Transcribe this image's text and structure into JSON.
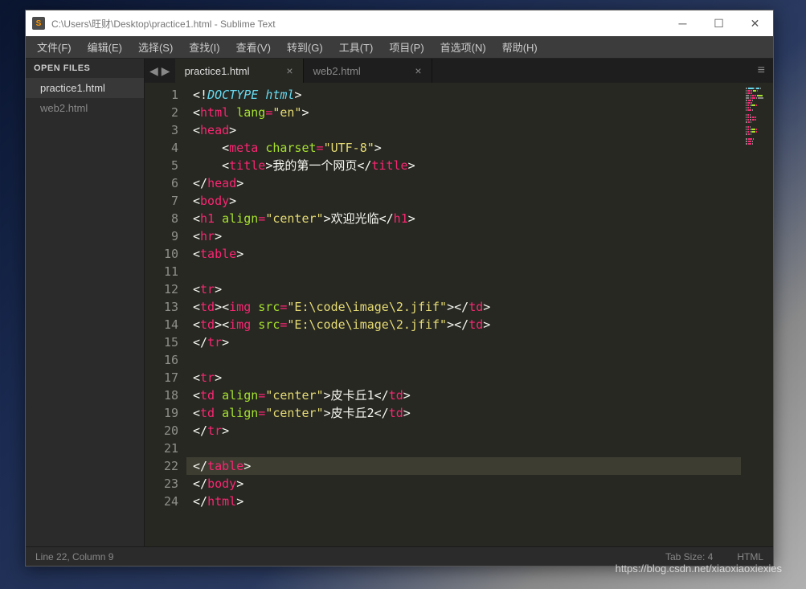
{
  "titlebar": {
    "icon_letter": "S",
    "title": "C:\\Users\\旺财\\Desktop\\practice1.html - Sublime Text"
  },
  "menubar": [
    "文件(F)",
    "编辑(E)",
    "选择(S)",
    "查找(I)",
    "查看(V)",
    "转到(G)",
    "工具(T)",
    "项目(P)",
    "首选项(N)",
    "帮助(H)"
  ],
  "sidebar": {
    "header": "OPEN FILES",
    "items": [
      "practice1.html",
      "web2.html"
    ],
    "active_index": 0
  },
  "tabs": {
    "items": [
      "practice1.html",
      "web2.html"
    ],
    "active_index": 0
  },
  "code_lines": [
    [
      {
        "t": "bracket",
        "v": "<!"
      },
      {
        "t": "doctype",
        "v": "DOCTYPE"
      },
      {
        "t": "bracket",
        "v": " "
      },
      {
        "t": "doctype",
        "v": "html"
      },
      {
        "t": "bracket",
        "v": ">"
      }
    ],
    [
      {
        "t": "bracket",
        "v": "<"
      },
      {
        "t": "tag",
        "v": "html"
      },
      {
        "t": "bracket",
        "v": " "
      },
      {
        "t": "attr",
        "v": "lang"
      },
      {
        "t": "op",
        "v": "="
      },
      {
        "t": "str",
        "v": "\"en\""
      },
      {
        "t": "bracket",
        "v": ">"
      }
    ],
    [
      {
        "t": "bracket",
        "v": "<"
      },
      {
        "t": "tag",
        "v": "head"
      },
      {
        "t": "bracket",
        "v": ">"
      }
    ],
    [
      {
        "t": "text",
        "v": "    "
      },
      {
        "t": "bracket",
        "v": "<"
      },
      {
        "t": "tag",
        "v": "meta"
      },
      {
        "t": "bracket",
        "v": " "
      },
      {
        "t": "attr",
        "v": "charset"
      },
      {
        "t": "op",
        "v": "="
      },
      {
        "t": "str",
        "v": "\"UTF-8\""
      },
      {
        "t": "bracket",
        "v": ">"
      }
    ],
    [
      {
        "t": "text",
        "v": "    "
      },
      {
        "t": "bracket",
        "v": "<"
      },
      {
        "t": "tag",
        "v": "title"
      },
      {
        "t": "bracket",
        "v": ">"
      },
      {
        "t": "text",
        "v": "我的第一个网页"
      },
      {
        "t": "bracket",
        "v": "</"
      },
      {
        "t": "tag",
        "v": "title"
      },
      {
        "t": "bracket",
        "v": ">"
      }
    ],
    [
      {
        "t": "bracket",
        "v": "</"
      },
      {
        "t": "tag",
        "v": "head"
      },
      {
        "t": "bracket",
        "v": ">"
      }
    ],
    [
      {
        "t": "bracket",
        "v": "<"
      },
      {
        "t": "tag",
        "v": "body"
      },
      {
        "t": "bracket",
        "v": ">"
      }
    ],
    [
      {
        "t": "bracket",
        "v": "<"
      },
      {
        "t": "tag",
        "v": "h1"
      },
      {
        "t": "bracket",
        "v": " "
      },
      {
        "t": "attr",
        "v": "align"
      },
      {
        "t": "op",
        "v": "="
      },
      {
        "t": "str",
        "v": "\"center\""
      },
      {
        "t": "bracket",
        "v": ">"
      },
      {
        "t": "text",
        "v": "欢迎光临"
      },
      {
        "t": "bracket",
        "v": "</"
      },
      {
        "t": "tag",
        "v": "h1"
      },
      {
        "t": "bracket",
        "v": ">"
      }
    ],
    [
      {
        "t": "bracket",
        "v": "<"
      },
      {
        "t": "tag",
        "v": "hr"
      },
      {
        "t": "bracket",
        "v": ">"
      }
    ],
    [
      {
        "t": "bracket",
        "v": "<"
      },
      {
        "t": "tag",
        "v": "table"
      },
      {
        "t": "bracket",
        "v": ">"
      }
    ],
    [],
    [
      {
        "t": "bracket",
        "v": "<"
      },
      {
        "t": "tag",
        "v": "tr"
      },
      {
        "t": "bracket",
        "v": ">"
      }
    ],
    [
      {
        "t": "bracket",
        "v": "<"
      },
      {
        "t": "tag",
        "v": "td"
      },
      {
        "t": "bracket",
        "v": "><"
      },
      {
        "t": "tag",
        "v": "img"
      },
      {
        "t": "bracket",
        "v": " "
      },
      {
        "t": "attr",
        "v": "src"
      },
      {
        "t": "op",
        "v": "="
      },
      {
        "t": "str",
        "v": "\"E:\\code\\image\\2.jfif\""
      },
      {
        "t": "bracket",
        "v": "></"
      },
      {
        "t": "tag",
        "v": "td"
      },
      {
        "t": "bracket",
        "v": ">"
      }
    ],
    [
      {
        "t": "bracket",
        "v": "<"
      },
      {
        "t": "tag",
        "v": "td"
      },
      {
        "t": "bracket",
        "v": "><"
      },
      {
        "t": "tag",
        "v": "img"
      },
      {
        "t": "bracket",
        "v": " "
      },
      {
        "t": "attr",
        "v": "src"
      },
      {
        "t": "op",
        "v": "="
      },
      {
        "t": "str",
        "v": "\"E:\\code\\image\\2.jfif\""
      },
      {
        "t": "bracket",
        "v": "></"
      },
      {
        "t": "tag",
        "v": "td"
      },
      {
        "t": "bracket",
        "v": ">"
      }
    ],
    [
      {
        "t": "bracket",
        "v": "</"
      },
      {
        "t": "tag",
        "v": "tr"
      },
      {
        "t": "bracket",
        "v": ">"
      }
    ],
    [],
    [
      {
        "t": "bracket",
        "v": "<"
      },
      {
        "t": "tag",
        "v": "tr"
      },
      {
        "t": "bracket",
        "v": ">"
      }
    ],
    [
      {
        "t": "bracket",
        "v": "<"
      },
      {
        "t": "tag",
        "v": "td"
      },
      {
        "t": "bracket",
        "v": " "
      },
      {
        "t": "attr",
        "v": "align"
      },
      {
        "t": "op",
        "v": "="
      },
      {
        "t": "str",
        "v": "\"center\""
      },
      {
        "t": "bracket",
        "v": ">"
      },
      {
        "t": "text",
        "v": "皮卡丘1"
      },
      {
        "t": "bracket",
        "v": "</"
      },
      {
        "t": "tag",
        "v": "td"
      },
      {
        "t": "bracket",
        "v": ">"
      }
    ],
    [
      {
        "t": "bracket",
        "v": "<"
      },
      {
        "t": "tag",
        "v": "td"
      },
      {
        "t": "bracket",
        "v": " "
      },
      {
        "t": "attr",
        "v": "align"
      },
      {
        "t": "op",
        "v": "="
      },
      {
        "t": "str",
        "v": "\"center\""
      },
      {
        "t": "bracket",
        "v": ">"
      },
      {
        "t": "text",
        "v": "皮卡丘2"
      },
      {
        "t": "bracket",
        "v": "</"
      },
      {
        "t": "tag",
        "v": "td"
      },
      {
        "t": "bracket",
        "v": ">"
      }
    ],
    [
      {
        "t": "bracket",
        "v": "</"
      },
      {
        "t": "tag",
        "v": "tr"
      },
      {
        "t": "bracket",
        "v": ">"
      }
    ],
    [],
    [
      {
        "t": "bracket",
        "v": "</"
      },
      {
        "t": "tag",
        "v": "table"
      },
      {
        "t": "bracket",
        "v": ">"
      }
    ],
    [
      {
        "t": "bracket",
        "v": "</"
      },
      {
        "t": "tag",
        "v": "body"
      },
      {
        "t": "bracket",
        "v": ">"
      }
    ],
    [
      {
        "t": "bracket",
        "v": "</"
      },
      {
        "t": "tag",
        "v": "html"
      },
      {
        "t": "bracket",
        "v": ">"
      }
    ]
  ],
  "highlighted_line": 22,
  "statusbar": {
    "left": "Line 22, Column 9",
    "tab_size": "Tab Size: 4",
    "syntax": "HTML"
  },
  "watermark": "https://blog.csdn.net/xiaoxiaoxiexies"
}
